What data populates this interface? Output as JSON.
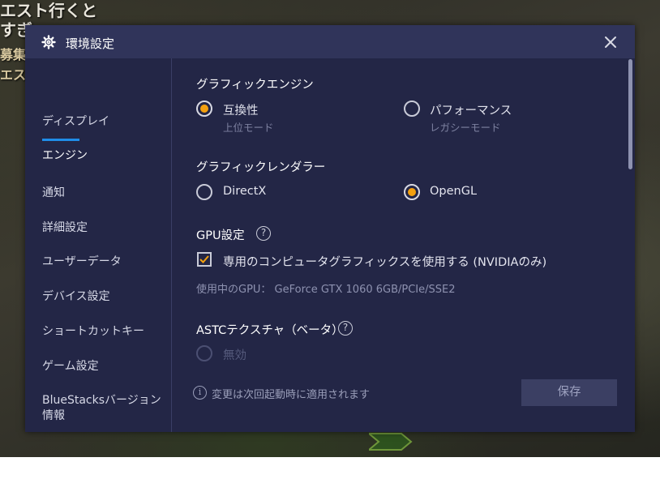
{
  "background": {
    "lines": [
      "エスト行くと",
      "すぎ",
      "募集",
      "エス"
    ]
  },
  "window": {
    "title": "環境設定",
    "title_icon": "gear-icon",
    "close_icon": "close-icon"
  },
  "sidebar": {
    "items": [
      {
        "label": "ディスプレイ",
        "active": false
      },
      {
        "label": "エンジン",
        "active": true
      },
      {
        "label": "通知",
        "active": false
      },
      {
        "label": "詳細設定",
        "active": false
      },
      {
        "label": "ユーザーデータ",
        "active": false
      },
      {
        "label": "デバイス設定",
        "active": false
      },
      {
        "label": "ショートカットキー",
        "active": false
      },
      {
        "label": "ゲーム設定",
        "active": false
      },
      {
        "label": "BlueStacksバージョン情報",
        "active": false
      }
    ]
  },
  "engine": {
    "graphics_engine": {
      "title": "グラフィックエンジン",
      "options": [
        {
          "label": "互換性",
          "sub": "上位モード",
          "selected": true
        },
        {
          "label": "パフォーマンス",
          "sub": "レガシーモード",
          "selected": false
        }
      ]
    },
    "graphics_renderer": {
      "title": "グラフィックレンダラー",
      "options": [
        {
          "label": "DirectX",
          "selected": false
        },
        {
          "label": "OpenGL",
          "selected": true
        }
      ]
    },
    "gpu": {
      "title": "GPU設定",
      "help": "?",
      "checkbox_label": "専用のコンピュータグラフィックスを使用する (NVIDIAのみ)",
      "checked": true,
      "in_use": "使用中のGPU： GeForce GTX 1060 6GB/PCIe/SSE2"
    },
    "astc": {
      "title": "ASTCテクスチャ（ベータ）",
      "help": "?",
      "option": {
        "label": "無効",
        "disabled": true
      }
    }
  },
  "footer": {
    "info_glyph": "i",
    "note": "変更は次回起動時に適用されます",
    "save_label": "保存"
  },
  "colors": {
    "dialog_bg": "#232646",
    "titlebar_bg": "#30345a",
    "accent_radio": "#f3a00f",
    "active_underline": "#1f8de8",
    "checkbox_check": "#f3a00f"
  }
}
